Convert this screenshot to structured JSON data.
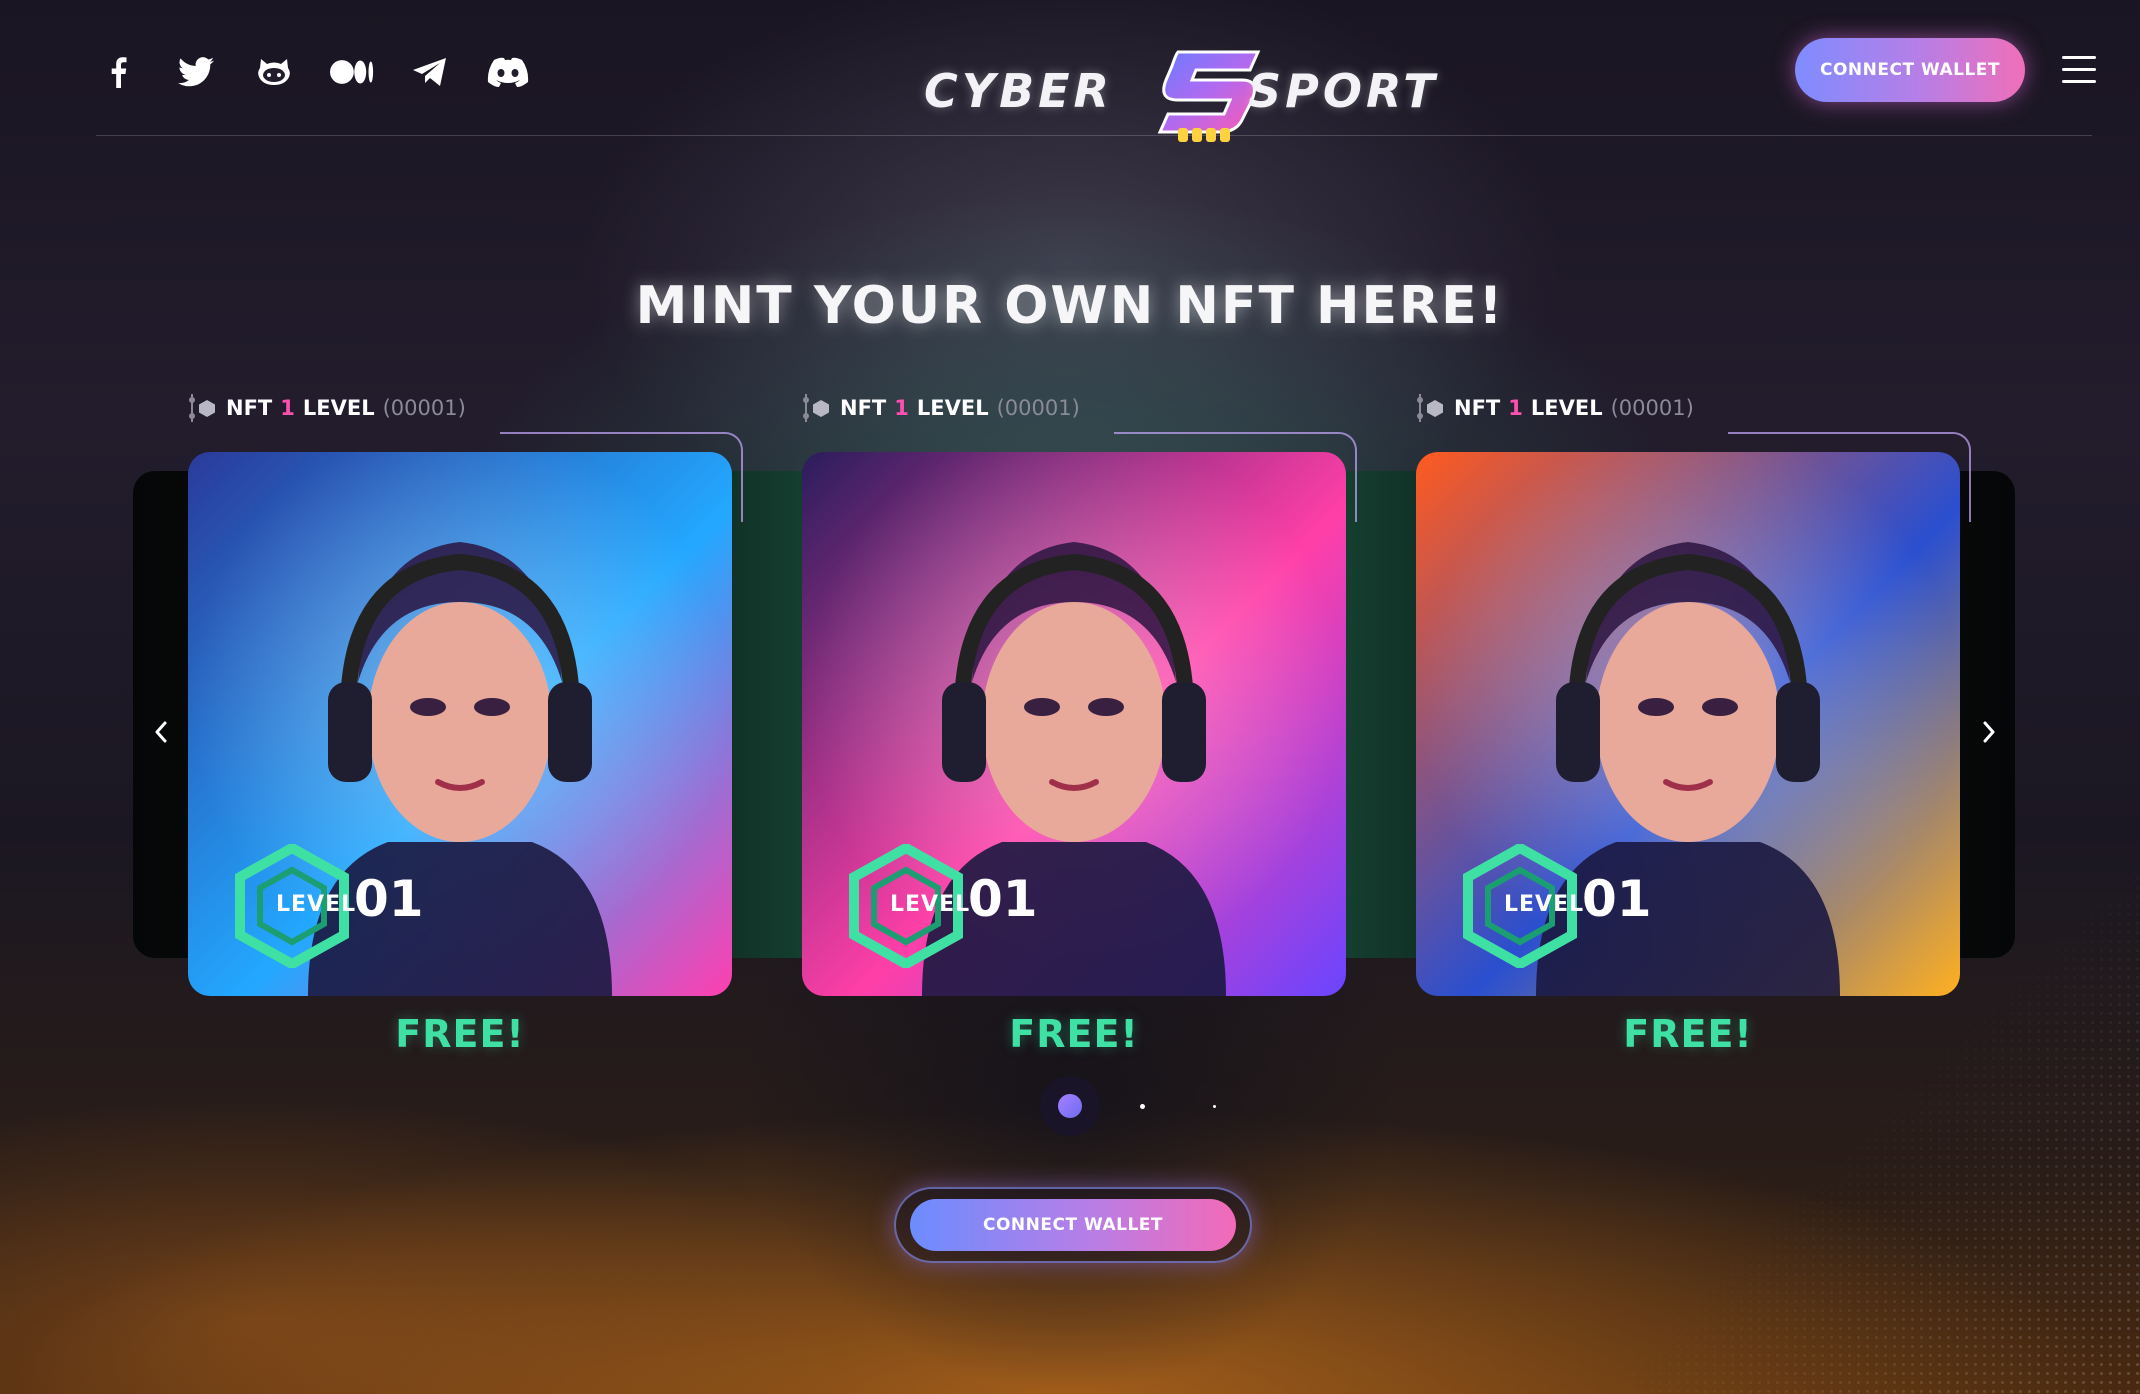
{
  "header": {
    "socials": [
      {
        "name": "facebook-icon"
      },
      {
        "name": "twitter-icon"
      },
      {
        "name": "github-icon"
      },
      {
        "name": "medium-icon"
      },
      {
        "name": "telegram-icon"
      },
      {
        "name": "discord-icon"
      }
    ],
    "logo": {
      "left": "CYBER",
      "right": "SPORT"
    },
    "connect_label": "CONNECT WALLET",
    "menu_icon": "hamburger-menu-icon"
  },
  "main": {
    "title": "MINT YOUR OWN NFT HERE!",
    "nfts": [
      {
        "prefix": "NFT",
        "level": "1",
        "suffix": "LEVEL",
        "code": "(00001)",
        "level_word": "LEVEL",
        "level_num": "01",
        "price": "FREE!",
        "palette": [
          "#2a3a9a",
          "#23a8ff",
          "#ff3fb0"
        ]
      },
      {
        "prefix": "NFT",
        "level": "1",
        "suffix": "LEVEL",
        "code": "(00001)",
        "level_word": "LEVEL",
        "level_num": "01",
        "price": "FREE!",
        "palette": [
          "#2a1d5c",
          "#ff3fa8",
          "#6a44ff"
        ]
      },
      {
        "prefix": "NFT",
        "level": "1",
        "suffix": "LEVEL",
        "code": "(00001)",
        "level_word": "LEVEL",
        "level_num": "01",
        "price": "FREE!",
        "palette": [
          "#ff5a1f",
          "#2a4fd0",
          "#ffb020"
        ]
      }
    ],
    "pagination": {
      "count": 3,
      "active": 0
    },
    "connect_label": "CONNECT WALLET"
  },
  "colors": {
    "accent_green": "#3fe0a4",
    "accent_pink": "#ff4fb0",
    "button_gradient_start": "#7f8cff",
    "button_gradient_end": "#f06fb8"
  }
}
